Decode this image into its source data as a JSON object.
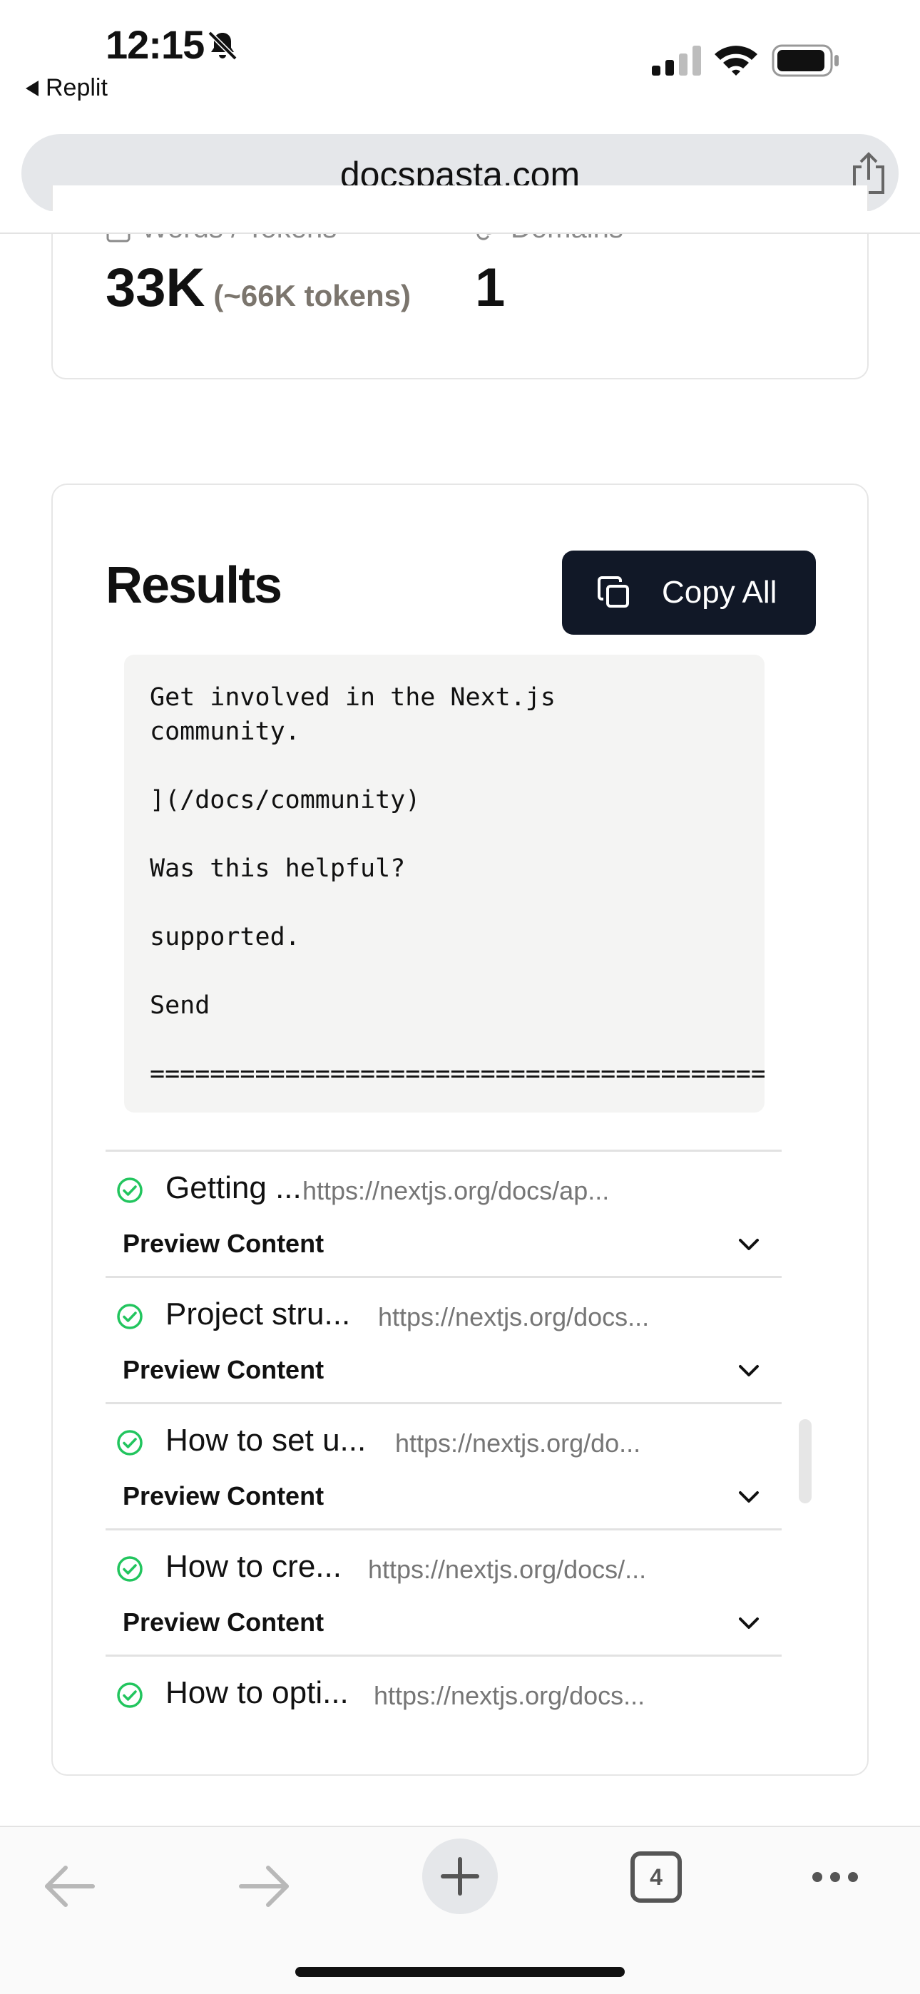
{
  "status_bar": {
    "time": "12:15",
    "back_app": "Replit"
  },
  "browser": {
    "url": "docspasta.com",
    "tab_count": "4"
  },
  "stats": {
    "words_label": "Words / Tokens",
    "words_value": "33K",
    "tokens_value": "(~66K tokens)",
    "domains_label": "Domains",
    "domains_value": "1"
  },
  "results": {
    "title": "Results",
    "copy_all_label": "Copy All",
    "code": "Get involved in the Next.js\ncommunity.\n\n](/docs/community)\n\nWas this helpful?\n\nsupported.\n\nSend\n\n=========================================",
    "preview_label": "Preview Content",
    "items": [
      {
        "title": "Getting ...",
        "url": "https://nextjs.org/docs/ap...",
        "status": "success"
      },
      {
        "title": "Project stru...",
        "url": "https://nextjs.org/docs...",
        "status": "success"
      },
      {
        "title": "How to set u...",
        "url": "https://nextjs.org/do...",
        "status": "success"
      },
      {
        "title": "How to cre...",
        "url": "https://nextjs.org/docs/...",
        "status": "success"
      },
      {
        "title": "How to opti...",
        "url": "https://nextjs.org/docs...",
        "status": "success"
      }
    ]
  },
  "icons": [
    "bell-slash-icon",
    "signal-icon",
    "wifi-icon",
    "battery-icon",
    "share-icon",
    "document-icon",
    "link-icon",
    "copy-icon",
    "check-circle-icon",
    "chevron-down-icon",
    "back-arrow-icon",
    "forward-arrow-icon",
    "plus-icon",
    "more-icon"
  ],
  "colors": {
    "button_dark": "#111827",
    "check_green": "#22c55e",
    "code_bg": "#f4f4f3",
    "url_bar_bg": "#e5e7ea"
  }
}
